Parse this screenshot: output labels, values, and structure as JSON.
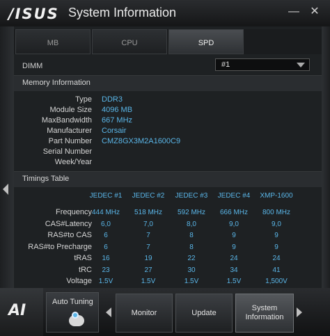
{
  "window": {
    "logo": "/ISUS",
    "title": "System Information"
  },
  "tabs": [
    {
      "label": "MB"
    },
    {
      "label": "CPU"
    },
    {
      "label": "SPD"
    }
  ],
  "dimm": {
    "label": "DIMM",
    "selected": "#1"
  },
  "memory": {
    "header": "Memory Information",
    "rows": [
      {
        "label": "Type",
        "value": "DDR3"
      },
      {
        "label": "Module Size",
        "value": "4096 MB"
      },
      {
        "label": "MaxBandwidth",
        "value": "667 MHz"
      },
      {
        "label": "Manufacturer",
        "value": "Corsair"
      },
      {
        "label": "Part Number",
        "value": "CMZ8GX3M2A1600C9"
      },
      {
        "label": "Serial Number",
        "value": ""
      },
      {
        "label": "Week/Year",
        "value": ""
      }
    ]
  },
  "timings": {
    "header": "Timings Table",
    "columns": [
      "JEDEC #1",
      "JEDEC #2",
      "JEDEC #3",
      "JEDEC #4",
      "XMP-1600"
    ],
    "rows": [
      {
        "label": "Frequency",
        "values": [
          "444 MHz",
          "518 MHz",
          "592 MHz",
          "666 MHz",
          "800 MHz"
        ]
      },
      {
        "label": "CAS#Latency",
        "values": [
          "6,0",
          "7,0",
          "8,0",
          "9,0",
          "9,0"
        ]
      },
      {
        "label": "RAS#to CAS",
        "values": [
          "6",
          "7",
          "8",
          "9",
          "9"
        ]
      },
      {
        "label": "RAS#to Precharge",
        "values": [
          "6",
          "7",
          "8",
          "9",
          "9"
        ]
      },
      {
        "label": "tRAS",
        "values": [
          "16",
          "19",
          "22",
          "24",
          "24"
        ]
      },
      {
        "label": "tRC",
        "values": [
          "23",
          "27",
          "30",
          "34",
          "41"
        ]
      },
      {
        "label": "Voltage",
        "values": [
          "1.5V",
          "1.5V",
          "1.5V",
          "1.5V",
          "1,500V"
        ]
      }
    ]
  },
  "bottom": {
    "ai_logo": "AI",
    "auto_tuning": "Auto Tuning",
    "buttons": [
      {
        "label": "Monitor"
      },
      {
        "label": "Update"
      },
      {
        "label": "System Information"
      }
    ]
  }
}
